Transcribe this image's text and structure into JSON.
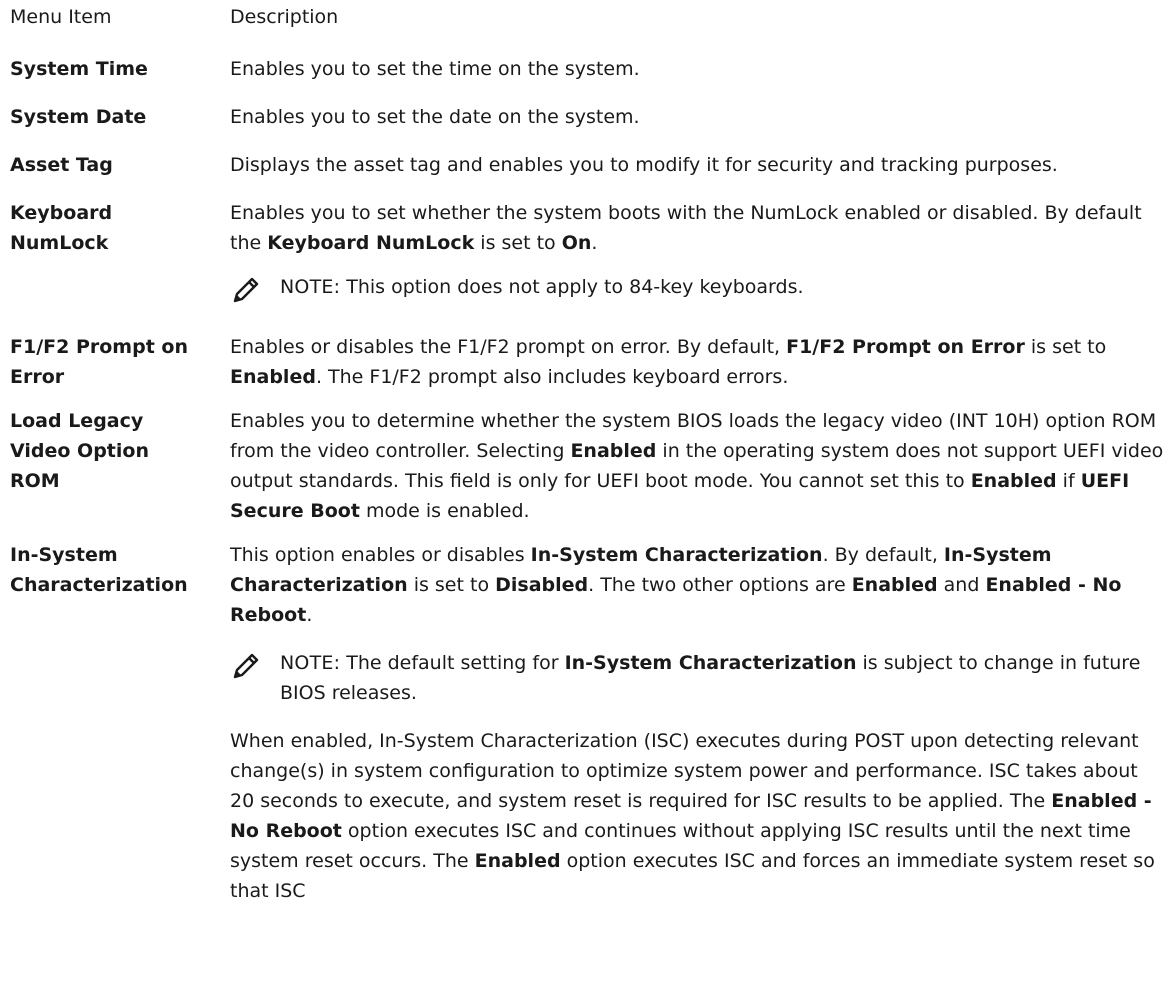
{
  "header": {
    "menu_item": "Menu Item",
    "description": "Description"
  },
  "rows": [
    {
      "item": "System Time",
      "description": "Enables you to set the time on the system."
    },
    {
      "item": "System Date",
      "description": "Enables you to set the date on the system."
    },
    {
      "item": "Asset Tag",
      "description": "Displays the asset tag and enables you to modify it for security and tracking purposes."
    },
    {
      "item_line1": "Keyboard",
      "item_line2": "NumLock",
      "desc_part1": "Enables you to set whether the system boots with the NumLock enabled or disabled. By default the ",
      "desc_bold1": "Keyboard NumLock",
      "desc_part2": " is set to ",
      "desc_bold2": "On",
      "desc_part3": ".",
      "note_label": "NOTE:",
      "note_text": " This option does not apply to 84-key keyboards."
    },
    {
      "item_line1": "F1/F2 Prompt on",
      "item_line2": "Error",
      "desc_part1": "Enables or disables the F1/F2 prompt on error. By default, ",
      "desc_bold1": "F1/F2 Prompt on Error",
      "desc_part2": " is set to ",
      "desc_bold2": "Enabled",
      "desc_part3": ". The F1/F2 prompt also includes keyboard errors."
    },
    {
      "item_line1": "Load Legacy",
      "item_line2": "Video Option",
      "item_line3": "ROM",
      "desc_part1": "Enables you to determine whether the system BIOS loads the legacy video (INT 10H) option ROM from the video controller. Selecting ",
      "desc_bold1": "Enabled",
      "desc_part2": " in the operating system does not support UEFI video output standards. This field is only for UEFI boot mode. You cannot set this to ",
      "desc_bold2": "Enabled",
      "desc_part3": " if ",
      "desc_bold3": "UEFI Secure Boot",
      "desc_part4": " mode is enabled."
    },
    {
      "item_line1": "In-System",
      "item_line2": "Characterization",
      "desc_part1": "This option enables or disables ",
      "desc_bold1": "In-System Characterization",
      "desc_part2": ". By default, ",
      "desc_bold2": "In-System Characterization",
      "desc_part3": " is set to ",
      "desc_bold3": "Disabled",
      "desc_part4": ". The two other options are ",
      "desc_bold4": "Enabled",
      "desc_part5": " and ",
      "desc_bold5": "Enabled - No Reboot",
      "desc_part6": ".",
      "note_label": "NOTE:",
      "note_part1": " The default setting for ",
      "note_bold1": "In-System Characterization",
      "note_part2": " is subject to change in future BIOS releases.",
      "para_part1": "When enabled, In-System Characterization (ISC) executes during POST upon detecting relevant change(s) in system configuration to optimize system power and performance. ISC takes about 20 seconds to execute, and system reset is required for ISC results to be applied. The ",
      "para_bold1": "Enabled - No Reboot",
      "para_part2": " option executes ISC and continues without applying ISC results until the next time system reset occurs. The ",
      "para_bold2": "Enabled",
      "para_part3": " option executes ISC and forces an immediate system reset so that ISC"
    }
  ],
  "icon": {
    "note": "pencil-note-icon",
    "color": "#1a1a1a"
  }
}
